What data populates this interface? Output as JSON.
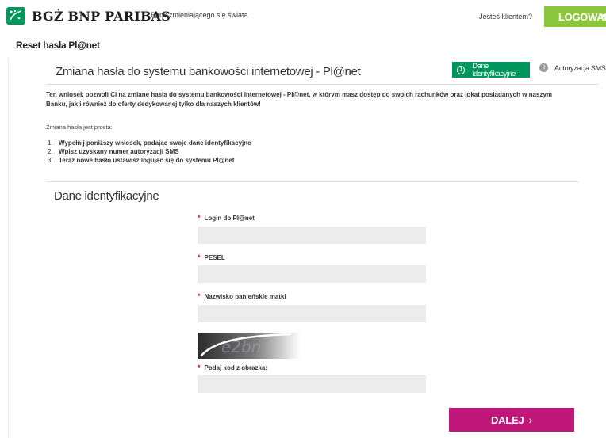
{
  "header": {
    "brand": "BGŻ BNP PARIBAS",
    "tagline": "Bank zmieniającego się świata",
    "client_question": "Jesteś klientem?",
    "login_label": "LOGOWANIE",
    "logo_icon": "stars-logo-icon",
    "brand_color": "#00965e",
    "login_color": "#8cc63f"
  },
  "page": {
    "title": "Reset hasła Pl@net"
  },
  "section": {
    "heading": "Zmiana hasła do systemu bankowości internetowej - Pl@net",
    "steps": [
      {
        "number": "1",
        "label": "Dane identyfikacyjne",
        "active": true
      },
      {
        "number": "2",
        "label": "Autoryzacja SMS",
        "active": false
      }
    ],
    "intro_text": "Ten wniosek pozwoli Ci na zmianę hasła do systemu bankowości internetowej - Pl@net, w którym masz dostęp do swoich rachunków oraz lokat posiadanych w naszym Banku, jak i również do oferty dedykowanej tylko dla naszych klientów!",
    "simple_text": "Zmiana hasła jest prosta:",
    "instructions": [
      {
        "n": "1.",
        "text": "Wypełnij poniższy wniosek, podając swoje dane identyfikacyjne"
      },
      {
        "n": "2.",
        "text": "Wpisz uzyskany numer autoryzacji SMS"
      },
      {
        "n": "3.",
        "text": "Teraz nowe hasło ustawisz logując się do systemu Pl@net"
      }
    ]
  },
  "form": {
    "heading": "Dane identyfikacyjne",
    "required_marker": "*",
    "fields": [
      {
        "label": "Login do Pl@net",
        "value": ""
      },
      {
        "label": "PESEL",
        "value": ""
      },
      {
        "label": "Nazwisko panieńskie matki",
        "value": ""
      },
      {
        "label": "Podaj kod z obrazka:",
        "value": ""
      }
    ],
    "captcha_text": "e2bn",
    "submit_label": "DALEJ",
    "submit_chevron": "›",
    "submit_color": "#c0187a"
  }
}
